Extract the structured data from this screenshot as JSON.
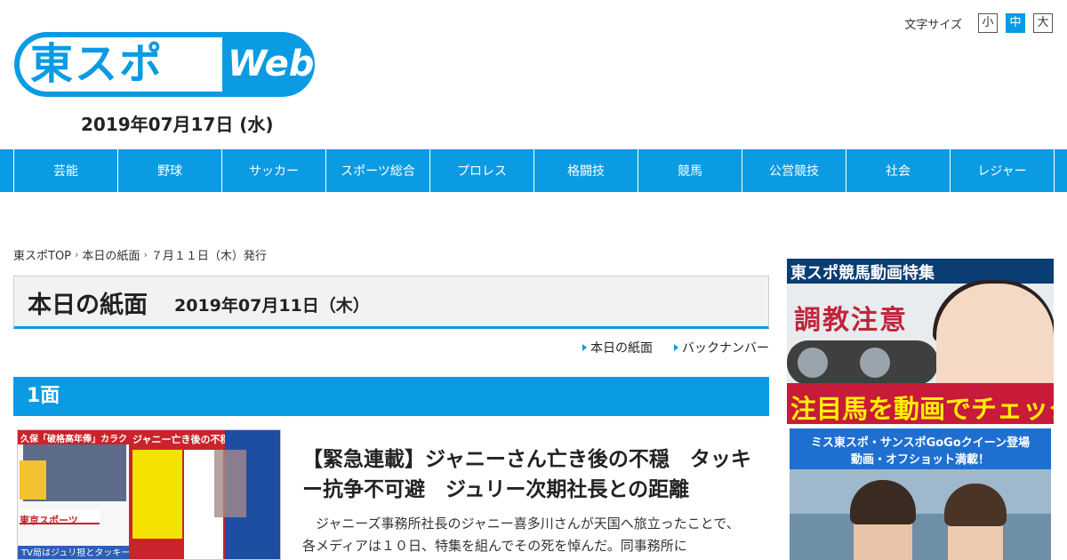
{
  "header": {
    "logo_jp": "東スポ",
    "logo_web": "Web",
    "date": "2019年07月17日 (水)",
    "font_size": {
      "label": "文字サイズ",
      "options": [
        "小",
        "中",
        "大"
      ],
      "selected": "中"
    }
  },
  "nav": {
    "items": [
      "芸能",
      "野球",
      "サッカー",
      "スポーツ総合",
      "プロレス",
      "格闘技",
      "競馬",
      "公営競技",
      "社会",
      "レジャー"
    ]
  },
  "breadcrumb": [
    "東スポTOP",
    "本日の紙面",
    "７月１１日（木）発行"
  ],
  "page_title": {
    "main": "本日の紙面",
    "date": "2019年07月11日（木）"
  },
  "sub_links": [
    "本日の紙面",
    "バックナンバー"
  ],
  "section": {
    "title": "1面"
  },
  "newspaper_thumb": {
    "top_text": "久保「破格高年俸」カラクリ",
    "logo": "東京スポーツ",
    "bottom_text": "TV局はジュリ担とタッキー担を配置",
    "right_top": "ジャニー亡き後の不穏"
  },
  "article": {
    "title": "【緊急連載】ジャニーさん亡き後の不穏　タッキー抗争不可避　ジュリー次期社長との距離",
    "body": "ジャニーズ事務所社長のジャニー喜多川さんが天国へ旅立ったことで、各メディアは１０日、特集を組んでその死を悼んだ。同事務所に"
  },
  "sidebar": {
    "banner1": {
      "title": "東スポ競馬動画特集",
      "overlay": "調教注意",
      "cta": "注目馬を動画でチェック！"
    },
    "banner2": {
      "line1": "ミス東スポ・サンスポGoGoクイーン登場",
      "line2": "動画・オフショット満載！"
    }
  },
  "colors": {
    "accent": "#0a9be3",
    "text": "#222222",
    "banner_red": "#c81a39",
    "banner_yellow": "#ffef00"
  }
}
